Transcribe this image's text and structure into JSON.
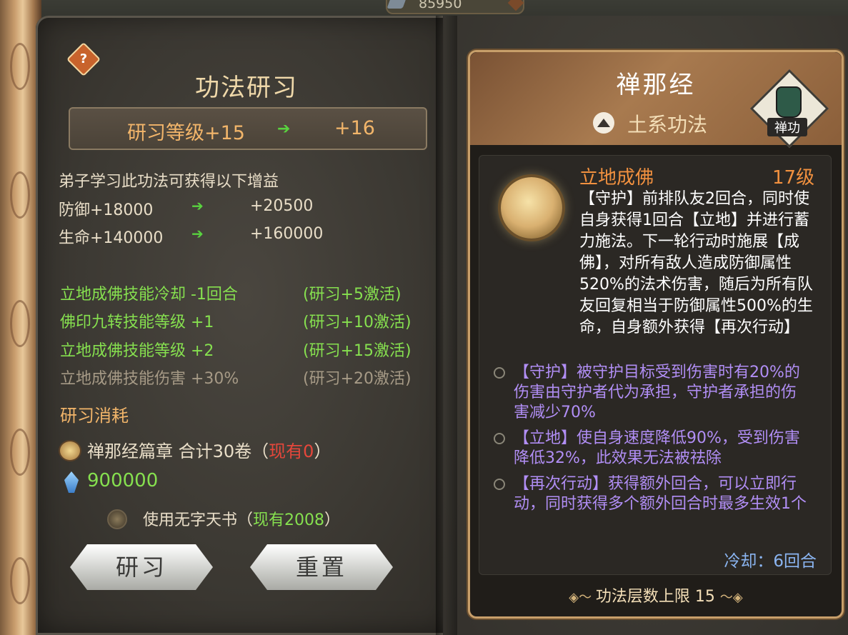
{
  "top": {
    "resource_value": "85950"
  },
  "left": {
    "help_label": "?",
    "title": "功法研习",
    "level": {
      "current": "研习等级+15",
      "arrow": "➔",
      "next": "+16"
    },
    "benefit_header": "弟子学习此功法可获得以下增益",
    "stats": [
      {
        "current": "防御+18000",
        "arrow": "➔",
        "next": "+20500"
      },
      {
        "current": "生命+140000",
        "arrow": "➔",
        "next": "+160000"
      }
    ],
    "unlocks": [
      {
        "text": "立地成佛技能冷却 -1回合",
        "req": "(研习+5激活)",
        "active": true
      },
      {
        "text": "佛印九转技能等级 +1",
        "req": "(研习+10激活)",
        "active": true
      },
      {
        "text": "立地成佛技能等级 +2",
        "req": "(研习+15激活)",
        "active": true
      },
      {
        "text": "立地成佛技能伤害 +30%",
        "req": "(研习+20激活)",
        "active": false
      }
    ],
    "cost_header": "研习消耗",
    "cost_item": {
      "name": "禅那经篇章  合计30卷（",
      "have": "现有0",
      "close": "）"
    },
    "money": "900000",
    "use_book": {
      "label": "使用无字天书（",
      "have": "现有2008",
      "close": "）"
    },
    "buttons": {
      "study": "研习",
      "reset": "重置"
    }
  },
  "card": {
    "title": "禅那经",
    "element_label": "土系功法",
    "badge_label": "禅功",
    "skill": {
      "name": "立地成佛",
      "level": "17级",
      "description": "【守护】前排队友2回合，同时使自身获得1回合【立地】并进行蓄力施法。下一轮行动时施展【成佛】，对所有敌人造成防御属性520%的法术伤害，随后为所有队友回复相当于防御属性500%的生命，自身额外获得【再次行动】"
    },
    "notes": [
      "【守护】被守护目标受到伤害时有20%的伤害由守护者代为承担，守护者承担的伤害减少70%",
      "【立地】使自身速度降低90%，受到伤害降低32%，此效果无法被祛除",
      "【再次行动】获得额外回合，可以立即行动，同时获得多个额外回合时最多生效1个"
    ],
    "cooldown": "冷却：6回合",
    "layer_limit": "功法层数上限 15"
  },
  "colors": {
    "active_green": "#86e04f",
    "inactive_gray": "#a69a86",
    "accent_orange": "#f2b56a",
    "note_purple": "#b18ef5",
    "cooldown_blue": "#8ab4f0",
    "shortage_red": "#e6473b"
  }
}
